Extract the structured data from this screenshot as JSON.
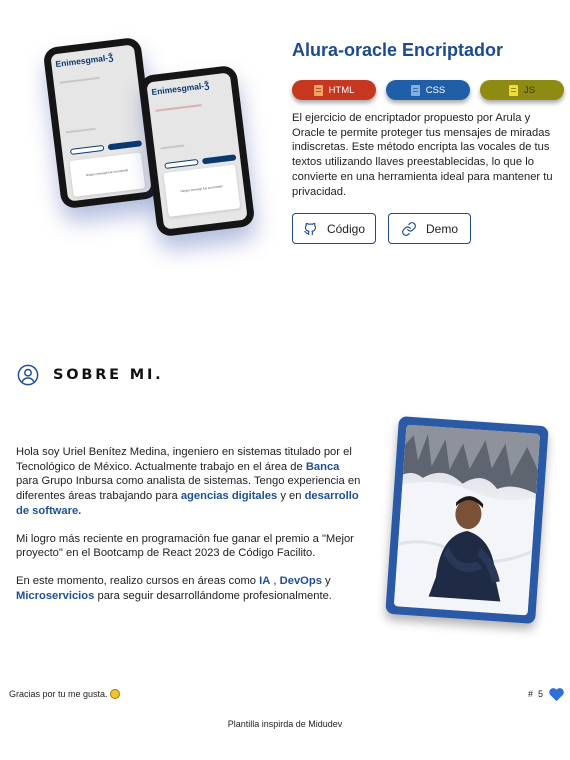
{
  "project": {
    "title": "Alura-oracle Encriptador",
    "preview": {
      "app_logo": "Enimesgmal-Ǯ",
      "screen_text": "Ningún mensaje fue encontrado"
    },
    "tags": [
      {
        "label": "HTML",
        "icon": "html5-icon",
        "color": "#c7361e"
      },
      {
        "label": "CSS",
        "icon": "css3-icon",
        "color": "#1f5fa8"
      },
      {
        "label": "JS",
        "icon": "js-icon",
        "color": "#8f8a12"
      }
    ],
    "description": "El ejercicio de encriptador propuesto por Arula y Oracle te permite proteger tus mensajes de miradas indiscretas. Este método encripta las vocales de tus textos utilizando llaves preestablecidas, lo que lo convierte en una herramienta ideal para mantener tu privacidad.",
    "buttons": {
      "code_label": "Código",
      "code_icon": "github-icon",
      "demo_label": "Demo",
      "demo_icon": "link-icon"
    }
  },
  "about": {
    "title": "SOBRE MI.",
    "icon": "user-circle-icon",
    "p1": {
      "a": "Hola soy Uriel Benítez Medina, ingeniero en sistemas titulado por el Tecnológico de México. Actualmente trabajo en el área de ",
      "b": "Banca",
      "c": " para Grupo Inbursa como analista de sistemas. Tengo experiencia en diferentes áreas trabajando para ",
      "d": "agencias digitales",
      "e": " y en ",
      "f": "desarrollo de software."
    },
    "p2": "Mi logro más reciente en programación fue ganar el premio a \"Mejor proyecto\" en el Bootcamp de React 2023 de Código Facilito.",
    "p3": {
      "a": "En este momento, realizo cursos en áreas como ",
      "b": "IA",
      "c": " , ",
      "d": "DevOps",
      "e": " y ",
      "f": "Microservicios",
      "g": " para seguir desarrollándome profesionalmente."
    }
  },
  "footer": {
    "thanks": "Gracias por tu me gusta.",
    "like_prefix": "#",
    "like_count": "5",
    "credit": "Plantilla inspirda de Midudev"
  },
  "colors": {
    "accent": "#1d4f9a",
    "title": "#1b4a8f",
    "heart": "#2f6fd6",
    "photo_frame": "#2a5aa6"
  }
}
